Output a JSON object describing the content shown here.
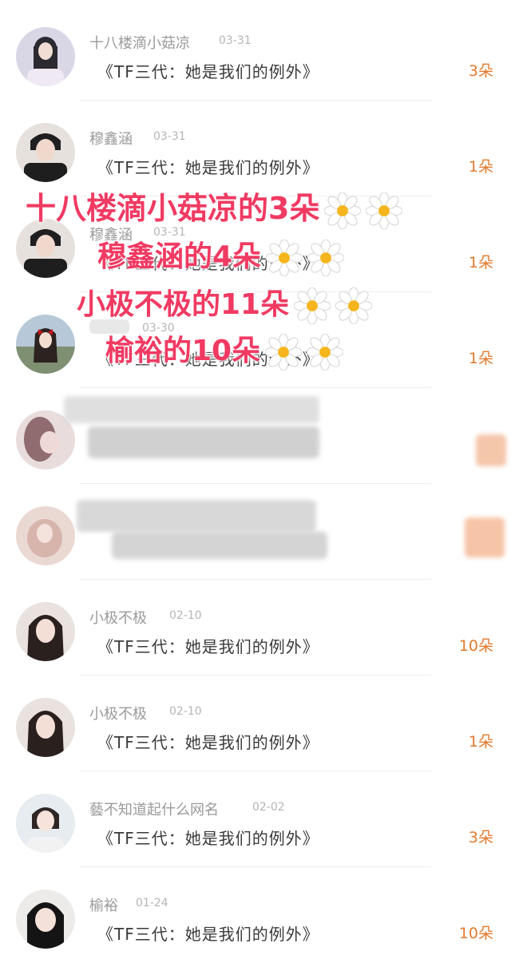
{
  "rows": [
    {
      "name": "十八楼滴小菇凉",
      "date": "03-31",
      "title": "《TF三代：她是我们的例外》",
      "count": "3朵"
    },
    {
      "name": "穆鑫涵",
      "date": "03-31",
      "title": "《TF三代：她是我们的例外》",
      "count": "1朵"
    },
    {
      "name": "穆鑫涵",
      "date": "03-31",
      "title": "《TF三代：她是我们的例外》",
      "count": "1朵"
    },
    {
      "name": "",
      "date": "03-30",
      "title": "《TF三代：她是我们的例外》",
      "count": "1朵"
    },
    {
      "name": "",
      "date": "",
      "title": "",
      "count": ""
    },
    {
      "name": "",
      "date": "",
      "title": "",
      "count": ""
    },
    {
      "name": "小极不极",
      "date": "02-10",
      "title": "《TF三代：她是我们的例外》",
      "count": "10朵"
    },
    {
      "name": "小极不极",
      "date": "02-10",
      "title": "《TF三代：她是我们的例外》",
      "count": "1朵"
    },
    {
      "name": "藝不知道起什么网名",
      "date": "02-02",
      "title": "《TF三代：她是我们的例外》",
      "count": "3朵"
    },
    {
      "name": "榆裕",
      "date": "01-24",
      "title": "《TF三代：她是我们的例外》",
      "count": "10朵"
    }
  ],
  "overlay": {
    "line1": "十八楼滴小菇凉的3朵",
    "line2": "穆鑫涵的4朵",
    "line3": "小极不极的11朵",
    "line4": "榆裕的10朵"
  },
  "icons": {
    "flower": "daisy-icon",
    "avatar": "avatar-photo"
  },
  "colors": {
    "count": "#e27a2e",
    "overlay_text": "#f03a62",
    "name": "#9a9a9a",
    "title": "#3a3a3a"
  }
}
